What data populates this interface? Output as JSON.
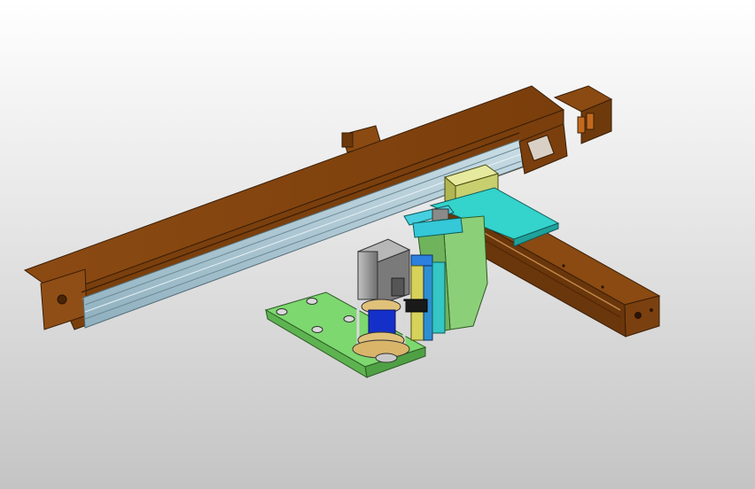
{
  "viewport": {
    "background_top": "#ffffff",
    "background_bottom": "#c4c4c4"
  },
  "model": {
    "colors": {
      "beam": "#8a4a12",
      "beam_dark": "#5c300a",
      "beam_light": "#a85f1e",
      "rail": "#a9c4cf",
      "slide_plate": "#2ec9c2",
      "yellow_block": "#d9df8f",
      "green_base": "#6fd46a",
      "green_vertical": "#8ccf79",
      "motor": "#9a9a9a",
      "coupling": "#1530c8",
      "cylinder_blue": "#2d7fe0",
      "cylinder_yellow": "#d7d25a"
    },
    "parts": [
      "horizontal-beam",
      "drive-motor-x",
      "linear-rail",
      "slide-carriage",
      "cross-arm",
      "vertical-slide",
      "servo-motor",
      "rotary-coupling",
      "mounting-plate"
    ]
  }
}
